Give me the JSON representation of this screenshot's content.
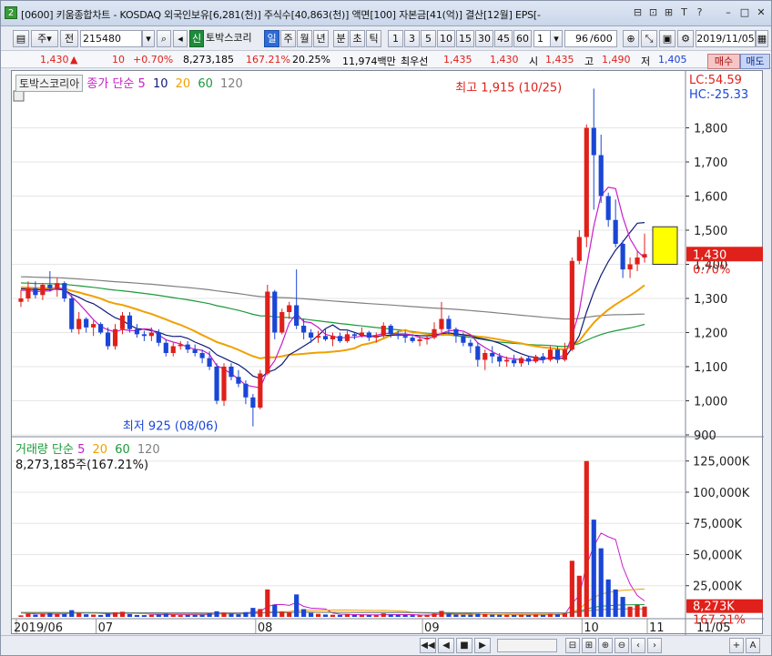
{
  "window": {
    "app_number": "2",
    "title": "[0600] 키움종합차트 - KOSDAQ 외국인보유[6,281(천)] 주식수[40,863(천)] 액면[100] 자본금[41(억)] 결산[12월] EPS[-",
    "title_icons": [
      "⊟",
      "⊡",
      "⊞",
      "T",
      "?"
    ],
    "buttons": [
      "–",
      "□",
      "✕"
    ]
  },
  "toolbar": {
    "period_type": "주",
    "prev_label": "전",
    "code": "215480",
    "new_label": "신",
    "stock_name": "토박스코리",
    "period_tabs": [
      "일",
      "주",
      "월",
      "년",
      "분",
      "초",
      "틱"
    ],
    "selected_tab": "일",
    "minute_options": [
      "1",
      "3",
      "5",
      "10",
      "15",
      "30",
      "45",
      "60"
    ],
    "unit_value": "1",
    "count_value": "96",
    "count_max": "/600",
    "date": "2019/11/05"
  },
  "quote": {
    "price": "1,430",
    "arrow": "▲",
    "change": "10",
    "change_pct": "+0.70%",
    "volume": "8,273,185",
    "volume_ratio": "167.21%",
    "turnover": "20.25%",
    "amount": "11,974백만",
    "priority_label": "최우선",
    "ask": "1,435",
    "bid": "1,430",
    "open_label": "시",
    "open": "1,435",
    "high_label": "고",
    "high": "1,490",
    "low_label": "저",
    "low": "1,405",
    "buy_label": "매수",
    "sell_label": "매도"
  },
  "chart_data": {
    "type": "candlestick",
    "stock": "토박스코리아",
    "price_legend": {
      "label": "종가 단순",
      "ma": [
        "5",
        "10",
        "20",
        "60",
        "120"
      ]
    },
    "volume_legend": {
      "label": "거래량 단순",
      "ma": [
        "5",
        "20",
        "60",
        "120"
      ]
    },
    "volume_value": "8,273,185주(167.21%)",
    "lc": "LC:54.59",
    "hc": "HC:-25.33",
    "current_price_label": "1,430",
    "current_pct_label": "0.70%",
    "current_volume_label": "8,273K",
    "current_volume_pct": "167.21%",
    "max_annotation": "최고 1,915 (10/25)",
    "min_annotation": "최저 925 (08/06)",
    "y_ticks": [
      "1,800",
      "1,700",
      "1,600",
      "1,500",
      "1,400",
      "1,300",
      "1,200",
      "1,100",
      "1,000",
      "900"
    ],
    "y_tick_values": [
      1800,
      1700,
      1600,
      1500,
      1400,
      1300,
      1200,
      1100,
      1000,
      900
    ],
    "vol_ticks": [
      "125,000K",
      "100,000K",
      "75,000K",
      "50,000K",
      "25,000K"
    ],
    "vol_tick_values": [
      125000,
      100000,
      75000,
      50000,
      25000
    ],
    "x_labels": [
      "2019/06",
      "07",
      "08",
      "09",
      "10",
      "11",
      "11/05"
    ],
    "ohlc": [
      [
        1290,
        1325,
        1275,
        1300
      ],
      [
        1300,
        1350,
        1290,
        1330
      ],
      [
        1330,
        1350,
        1300,
        1310
      ],
      [
        1310,
        1345,
        1295,
        1340
      ],
      [
        1340,
        1380,
        1320,
        1330
      ],
      [
        1330,
        1360,
        1305,
        1345
      ],
      [
        1345,
        1350,
        1290,
        1300
      ],
      [
        1300,
        1310,
        1200,
        1210
      ],
      [
        1210,
        1260,
        1195,
        1240
      ],
      [
        1240,
        1245,
        1200,
        1215
      ],
      [
        1215,
        1235,
        1190,
        1225
      ],
      [
        1225,
        1230,
        1195,
        1200
      ],
      [
        1200,
        1215,
        1150,
        1160
      ],
      [
        1160,
        1225,
        1150,
        1210
      ],
      [
        1210,
        1260,
        1195,
        1250
      ],
      [
        1250,
        1260,
        1200,
        1210
      ],
      [
        1210,
        1225,
        1185,
        1195
      ],
      [
        1195,
        1205,
        1175,
        1190
      ],
      [
        1190,
        1215,
        1175,
        1200
      ],
      [
        1200,
        1210,
        1160,
        1170
      ],
      [
        1170,
        1180,
        1130,
        1140
      ],
      [
        1140,
        1170,
        1130,
        1160
      ],
      [
        1160,
        1175,
        1150,
        1165
      ],
      [
        1165,
        1175,
        1140,
        1150
      ],
      [
        1150,
        1165,
        1130,
        1140
      ],
      [
        1140,
        1150,
        1110,
        1125
      ],
      [
        1125,
        1145,
        1090,
        1100
      ],
      [
        1100,
        1110,
        990,
        1000
      ],
      [
        1000,
        1110,
        985,
        1100
      ],
      [
        1100,
        1110,
        1060,
        1070
      ],
      [
        1070,
        1090,
        1040,
        1050
      ],
      [
        1050,
        1060,
        990,
        1010
      ],
      [
        1010,
        1020,
        925,
        980
      ],
      [
        980,
        1090,
        975,
        1080
      ],
      [
        1080,
        1340,
        1075,
        1320
      ],
      [
        1320,
        1325,
        1180,
        1200
      ],
      [
        1200,
        1270,
        1195,
        1260
      ],
      [
        1260,
        1290,
        1240,
        1280
      ],
      [
        1280,
        1385,
        1210,
        1220
      ],
      [
        1220,
        1240,
        1180,
        1200
      ],
      [
        1200,
        1210,
        1170,
        1185
      ],
      [
        1185,
        1205,
        1170,
        1190
      ],
      [
        1190,
        1210,
        1175,
        1180
      ],
      [
        1180,
        1200,
        1160,
        1190
      ],
      [
        1190,
        1200,
        1170,
        1175
      ],
      [
        1175,
        1205,
        1170,
        1195
      ],
      [
        1195,
        1200,
        1180,
        1190
      ],
      [
        1190,
        1215,
        1185,
        1200
      ],
      [
        1200,
        1205,
        1175,
        1185
      ],
      [
        1185,
        1200,
        1170,
        1190
      ],
      [
        1190,
        1230,
        1185,
        1220
      ],
      [
        1220,
        1225,
        1185,
        1195
      ],
      [
        1195,
        1205,
        1180,
        1190
      ],
      [
        1190,
        1205,
        1170,
        1185
      ],
      [
        1185,
        1195,
        1170,
        1175
      ],
      [
        1175,
        1190,
        1160,
        1180
      ],
      [
        1180,
        1190,
        1165,
        1185
      ],
      [
        1185,
        1230,
        1180,
        1210
      ],
      [
        1210,
        1290,
        1200,
        1240
      ],
      [
        1240,
        1250,
        1195,
        1210
      ],
      [
        1210,
        1215,
        1170,
        1190
      ],
      [
        1190,
        1200,
        1160,
        1170
      ],
      [
        1170,
        1180,
        1140,
        1160
      ],
      [
        1160,
        1170,
        1100,
        1120
      ],
      [
        1120,
        1150,
        1090,
        1140
      ],
      [
        1140,
        1160,
        1110,
        1130
      ],
      [
        1130,
        1140,
        1100,
        1115
      ],
      [
        1115,
        1130,
        1100,
        1120
      ],
      [
        1120,
        1135,
        1100,
        1110
      ],
      [
        1110,
        1130,
        1100,
        1125
      ],
      [
        1125,
        1130,
        1105,
        1115
      ],
      [
        1115,
        1135,
        1110,
        1130
      ],
      [
        1130,
        1140,
        1110,
        1120
      ],
      [
        1120,
        1160,
        1115,
        1150
      ],
      [
        1150,
        1160,
        1110,
        1120
      ],
      [
        1120,
        1170,
        1115,
        1150
      ],
      [
        1150,
        1420,
        1145,
        1410
      ],
      [
        1410,
        1500,
        1400,
        1480
      ],
      [
        1480,
        1810,
        1450,
        1800
      ],
      [
        1800,
        1915,
        1560,
        1720
      ],
      [
        1720,
        1780,
        1580,
        1600
      ],
      [
        1600,
        1610,
        1510,
        1530
      ],
      [
        1530,
        1590,
        1450,
        1460
      ],
      [
        1460,
        1470,
        1360,
        1385
      ],
      [
        1385,
        1420,
        1360,
        1400
      ],
      [
        1400,
        1440,
        1380,
        1420
      ],
      [
        1420,
        1490,
        1405,
        1430
      ]
    ],
    "volume": [
      1200,
      2500,
      1800,
      2600,
      3000,
      2200,
      2400,
      5400,
      3200,
      2100,
      1800,
      1500,
      2800,
      3600,
      4100,
      2300,
      1500,
      1400,
      1700,
      2000,
      2500,
      1800,
      1400,
      1500,
      1600,
      1900,
      2800,
      4500,
      3400,
      2600,
      2100,
      3800,
      7200,
      6300,
      22000,
      9800,
      4200,
      3600,
      18000,
      6200,
      3200,
      2400,
      1900,
      1700,
      1600,
      2300,
      1500,
      1600,
      1500,
      1400,
      2800,
      1900,
      1600,
      1500,
      1400,
      1300,
      1500,
      2600,
      4800,
      2500,
      1900,
      1700,
      1800,
      2600,
      2300,
      1800,
      1700,
      1600,
      1500,
      1700,
      1500,
      1900,
      1600,
      2300,
      2100,
      2800,
      45000,
      33000,
      125000,
      78000,
      55000,
      30000,
      22000,
      16000,
      8200,
      9500,
      8273
    ],
    "price_range": [
      900,
      1900
    ],
    "volume_range": [
      0,
      135000
    ],
    "colors": {
      "up": "#e0201a",
      "down": "#1a46d6",
      "ma5": "#c81ec8",
      "ma10": "#101a7a",
      "ma20": "#f0a000",
      "ma60": "#1a9a3a",
      "ma120": "#808080",
      "vol_ma5": "#c81ec8",
      "vol_ma20": "#f0a000",
      "vol_ma60": "#1a9a3a",
      "vol_ma120": "#808080"
    }
  },
  "statusbar": {
    "buttons": [
      "◀◀",
      "◀",
      "■",
      "▶"
    ],
    "right_icons": [
      "⊟",
      "⊞",
      "⊕",
      "⊖",
      "‹",
      "›",
      "+",
      "A"
    ]
  }
}
